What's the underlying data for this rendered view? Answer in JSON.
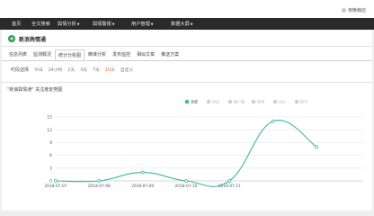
{
  "header": {
    "admin_label": "夜晚萌店",
    "nav": [
      {
        "label": "首页",
        "caret": false
      },
      {
        "label": "全文搜索",
        "caret": false
      },
      {
        "label": "舆情分析",
        "caret": true
      },
      {
        "label": "舆情警报",
        "caret": true
      },
      {
        "label": "用户管理",
        "caret": true
      },
      {
        "label": "数据大屏",
        "caret": true
      }
    ]
  },
  "page": {
    "title": "新浪舆情通",
    "tabs": [
      {
        "label": "信息列表",
        "active": false
      },
      {
        "label": "监测概况",
        "active": false
      },
      {
        "label": "统计分析图",
        "active": true
      },
      {
        "label": "精准分析",
        "active": false
      },
      {
        "label": "发布监控",
        "active": false
      },
      {
        "label": "相似文章",
        "active": false
      },
      {
        "label": "推送方案",
        "active": false
      }
    ],
    "time_filter": {
      "label": "时段选择",
      "options": [
        {
          "label": "今日",
          "selected": false
        },
        {
          "label": "24小时",
          "selected": false
        },
        {
          "label": "2天",
          "selected": false
        },
        {
          "label": "3天",
          "selected": false
        },
        {
          "label": "7天",
          "selected": false
        },
        {
          "label": "10天",
          "selected": true
        },
        {
          "label": "自定义",
          "selected": false
        }
      ]
    },
    "chart_title": "\"新浪舆情通\" 关注度走势图"
  },
  "chart_data": {
    "type": "line",
    "x": [
      "2018-07-07",
      "2018-07-08",
      "2018-07-09",
      "2018-07-10",
      "2018-07-11",
      "2018-07-12",
      "2018-07-13"
    ],
    "ylim": [
      0,
      15
    ],
    "yticks": [
      0,
      3,
      6,
      9,
      12,
      15
    ],
    "xtick_labels": [
      "2018-07-07",
      "2018-07-08",
      "2018-07-09",
      "2018-07-10",
      "2018-07-11"
    ],
    "legend": [
      "全部",
      "网站",
      "客户端",
      "微博",
      "论坛",
      "报刊"
    ],
    "legend_active": "全部",
    "series": [
      {
        "name": "全部",
        "values": [
          0,
          0,
          2,
          0,
          0,
          14,
          8
        ],
        "color": "#3db99a"
      }
    ],
    "grid": true
  }
}
